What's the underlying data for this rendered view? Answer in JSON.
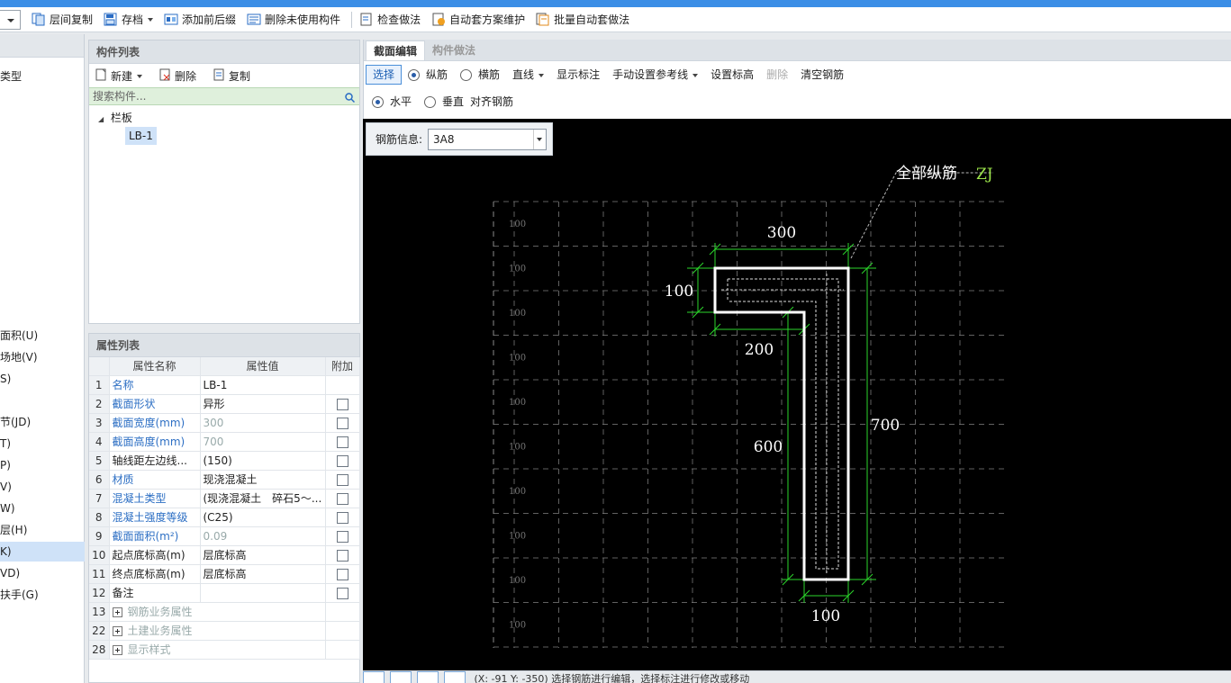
{
  "toolbar": {
    "items": [
      {
        "label": "层间复制",
        "icon": "copy-layers-icon"
      },
      {
        "label": "存档",
        "icon": "save-archive-icon"
      },
      {
        "label": "添加前后缀",
        "icon": "prefix-suffix-icon"
      },
      {
        "label": "删除未使用构件",
        "icon": "delete-unused-icon"
      },
      {
        "label": "检查做法",
        "icon": "check-method-icon"
      },
      {
        "label": "自动套方案维护",
        "icon": "auto-scheme-icon"
      },
      {
        "label": "批量自动套做法",
        "icon": "batch-auto-icon"
      }
    ]
  },
  "leftstrip": {
    "items": [
      {
        "label": "类型"
      },
      {
        "label": "面积(U)"
      },
      {
        "label": "场地(V)"
      },
      {
        "label": "S)"
      },
      {
        "label": "节(JD)"
      },
      {
        "label": "T)"
      },
      {
        "label": "P)"
      },
      {
        "label": "V)"
      },
      {
        "label": "W)"
      },
      {
        "label": "层(H)"
      },
      {
        "label": "K)"
      },
      {
        "label": "VD)"
      },
      {
        "label": "扶手(G)"
      }
    ]
  },
  "complist": {
    "title": "构件列表",
    "new_label": "新建",
    "delete_label": "删除",
    "copy_label": "复制",
    "search_placeholder": "搜索构件...",
    "tree": {
      "group": "栏板",
      "child": "LB-1"
    }
  },
  "props": {
    "title": "属性列表",
    "headers": {
      "name": "属性名称",
      "value": "属性值",
      "extra": "附加"
    },
    "rows": [
      {
        "n": "1",
        "name": "名称",
        "value": "LB-1",
        "blue": true,
        "gray": false,
        "check": false
      },
      {
        "n": "2",
        "name": "截面形状",
        "value": "异形",
        "blue": true,
        "gray": false,
        "check": true
      },
      {
        "n": "3",
        "name": "截面宽度(mm)",
        "value": "300",
        "blue": true,
        "gray": true,
        "check": true
      },
      {
        "n": "4",
        "name": "截面高度(mm)",
        "value": "700",
        "blue": true,
        "gray": true,
        "check": true
      },
      {
        "n": "5",
        "name": "轴线距左边线...",
        "value": "(150)",
        "blue": false,
        "gray": false,
        "check": true
      },
      {
        "n": "6",
        "name": "材质",
        "value": "现浇混凝土",
        "blue": true,
        "gray": false,
        "check": true
      },
      {
        "n": "7",
        "name": "混凝土类型",
        "value": "(现浇混凝土　碎石5～...",
        "blue": true,
        "gray": false,
        "check": true
      },
      {
        "n": "8",
        "name": "混凝土强度等级",
        "value": "(C25)",
        "blue": true,
        "gray": false,
        "check": true
      },
      {
        "n": "9",
        "name": "截面面积(m²)",
        "value": "0.09",
        "blue": true,
        "gray": true,
        "check": true
      },
      {
        "n": "10",
        "name": "起点底标高(m)",
        "value": "层底标高",
        "blue": false,
        "gray": false,
        "check": true
      },
      {
        "n": "11",
        "name": "终点底标高(m)",
        "value": "层底标高",
        "blue": false,
        "gray": false,
        "check": true
      },
      {
        "n": "12",
        "name": "备注",
        "value": "",
        "blue": false,
        "gray": false,
        "check": true
      }
    ],
    "groups": [
      {
        "n": "13",
        "name": "钢筋业务属性"
      },
      {
        "n": "22",
        "name": "土建业务属性"
      },
      {
        "n": "28",
        "name": "显示样式"
      }
    ]
  },
  "editor": {
    "tabs": [
      "截面编辑",
      "构件做法"
    ],
    "tb1": {
      "select": "选择",
      "longitudinal": "纵筋",
      "transverse": "横筋",
      "line": "直线",
      "show_dims": "显示标注",
      "manual_ref": "手动设置参考线",
      "set_elev": "设置标高",
      "delete": "删除",
      "clear": "清空钢筋"
    },
    "tb2": {
      "horizontal": "水平",
      "vertical": "垂直",
      "align": "对齐钢筋"
    },
    "rebar_label": "钢筋信息:",
    "rebar_value": "3A8"
  },
  "canvas": {
    "annotation": "全部纵筋",
    "annotation_code": "ZJ",
    "grid_label": "100",
    "dims": {
      "top": "300",
      "left": "100",
      "inner": "200",
      "height_inner": "600",
      "height_outer": "700",
      "bottom": "100"
    },
    "colors": {
      "shape": "#ffffff",
      "dim": "#2bd62b",
      "grid": "#8a8a8a",
      "code": "#9be34a"
    }
  },
  "status": {
    "text": "(X: -91 Y: -350) 选择钢筋进行编辑，选择标注进行修改或移动"
  }
}
